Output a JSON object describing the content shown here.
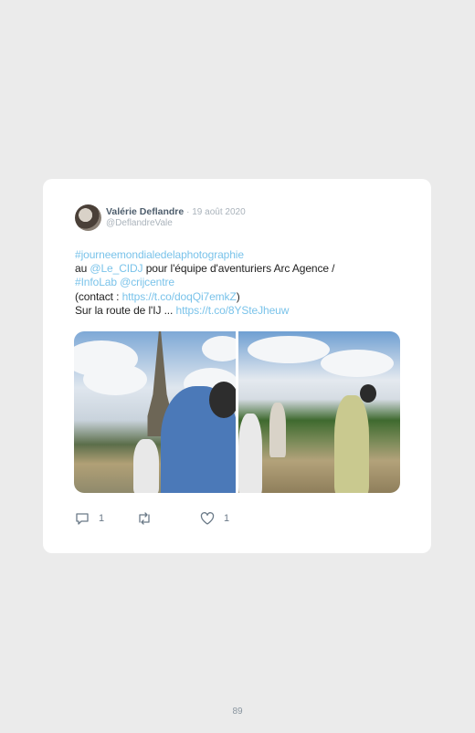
{
  "tweet": {
    "author_name": "Valérie Deflandre",
    "date": "· 19 août 2020",
    "handle": "@DeflandreVale",
    "hashtag_main": "#journeemondialedelaphotographie",
    "line2_prefix": "au ",
    "mention_cidj": "@Le_CIDJ",
    "line2_suffix": " pour l'équipe d'aventuriers Arc Agence /",
    "hashtag_infolab": "#InfoLab",
    "mention_crij": "@crijcentre",
    "contact_prefix": "(contact : ",
    "contact_link": "https://t.co/doqQi7emkZ",
    "contact_suffix": ")",
    "route_prefix": "Sur la route de l'IJ ... ",
    "route_link": "https://t.co/8YSteJheuw",
    "reply_count": "1",
    "like_count": "1"
  },
  "icons": {
    "reply": "reply-icon",
    "retweet": "retweet-icon",
    "like": "heart-icon"
  },
  "colors": {
    "link": "#7ac3ea",
    "name": "#4d5d6c",
    "muted": "#aab3bb",
    "background": "#ebebeb"
  },
  "page": {
    "number": "89"
  }
}
